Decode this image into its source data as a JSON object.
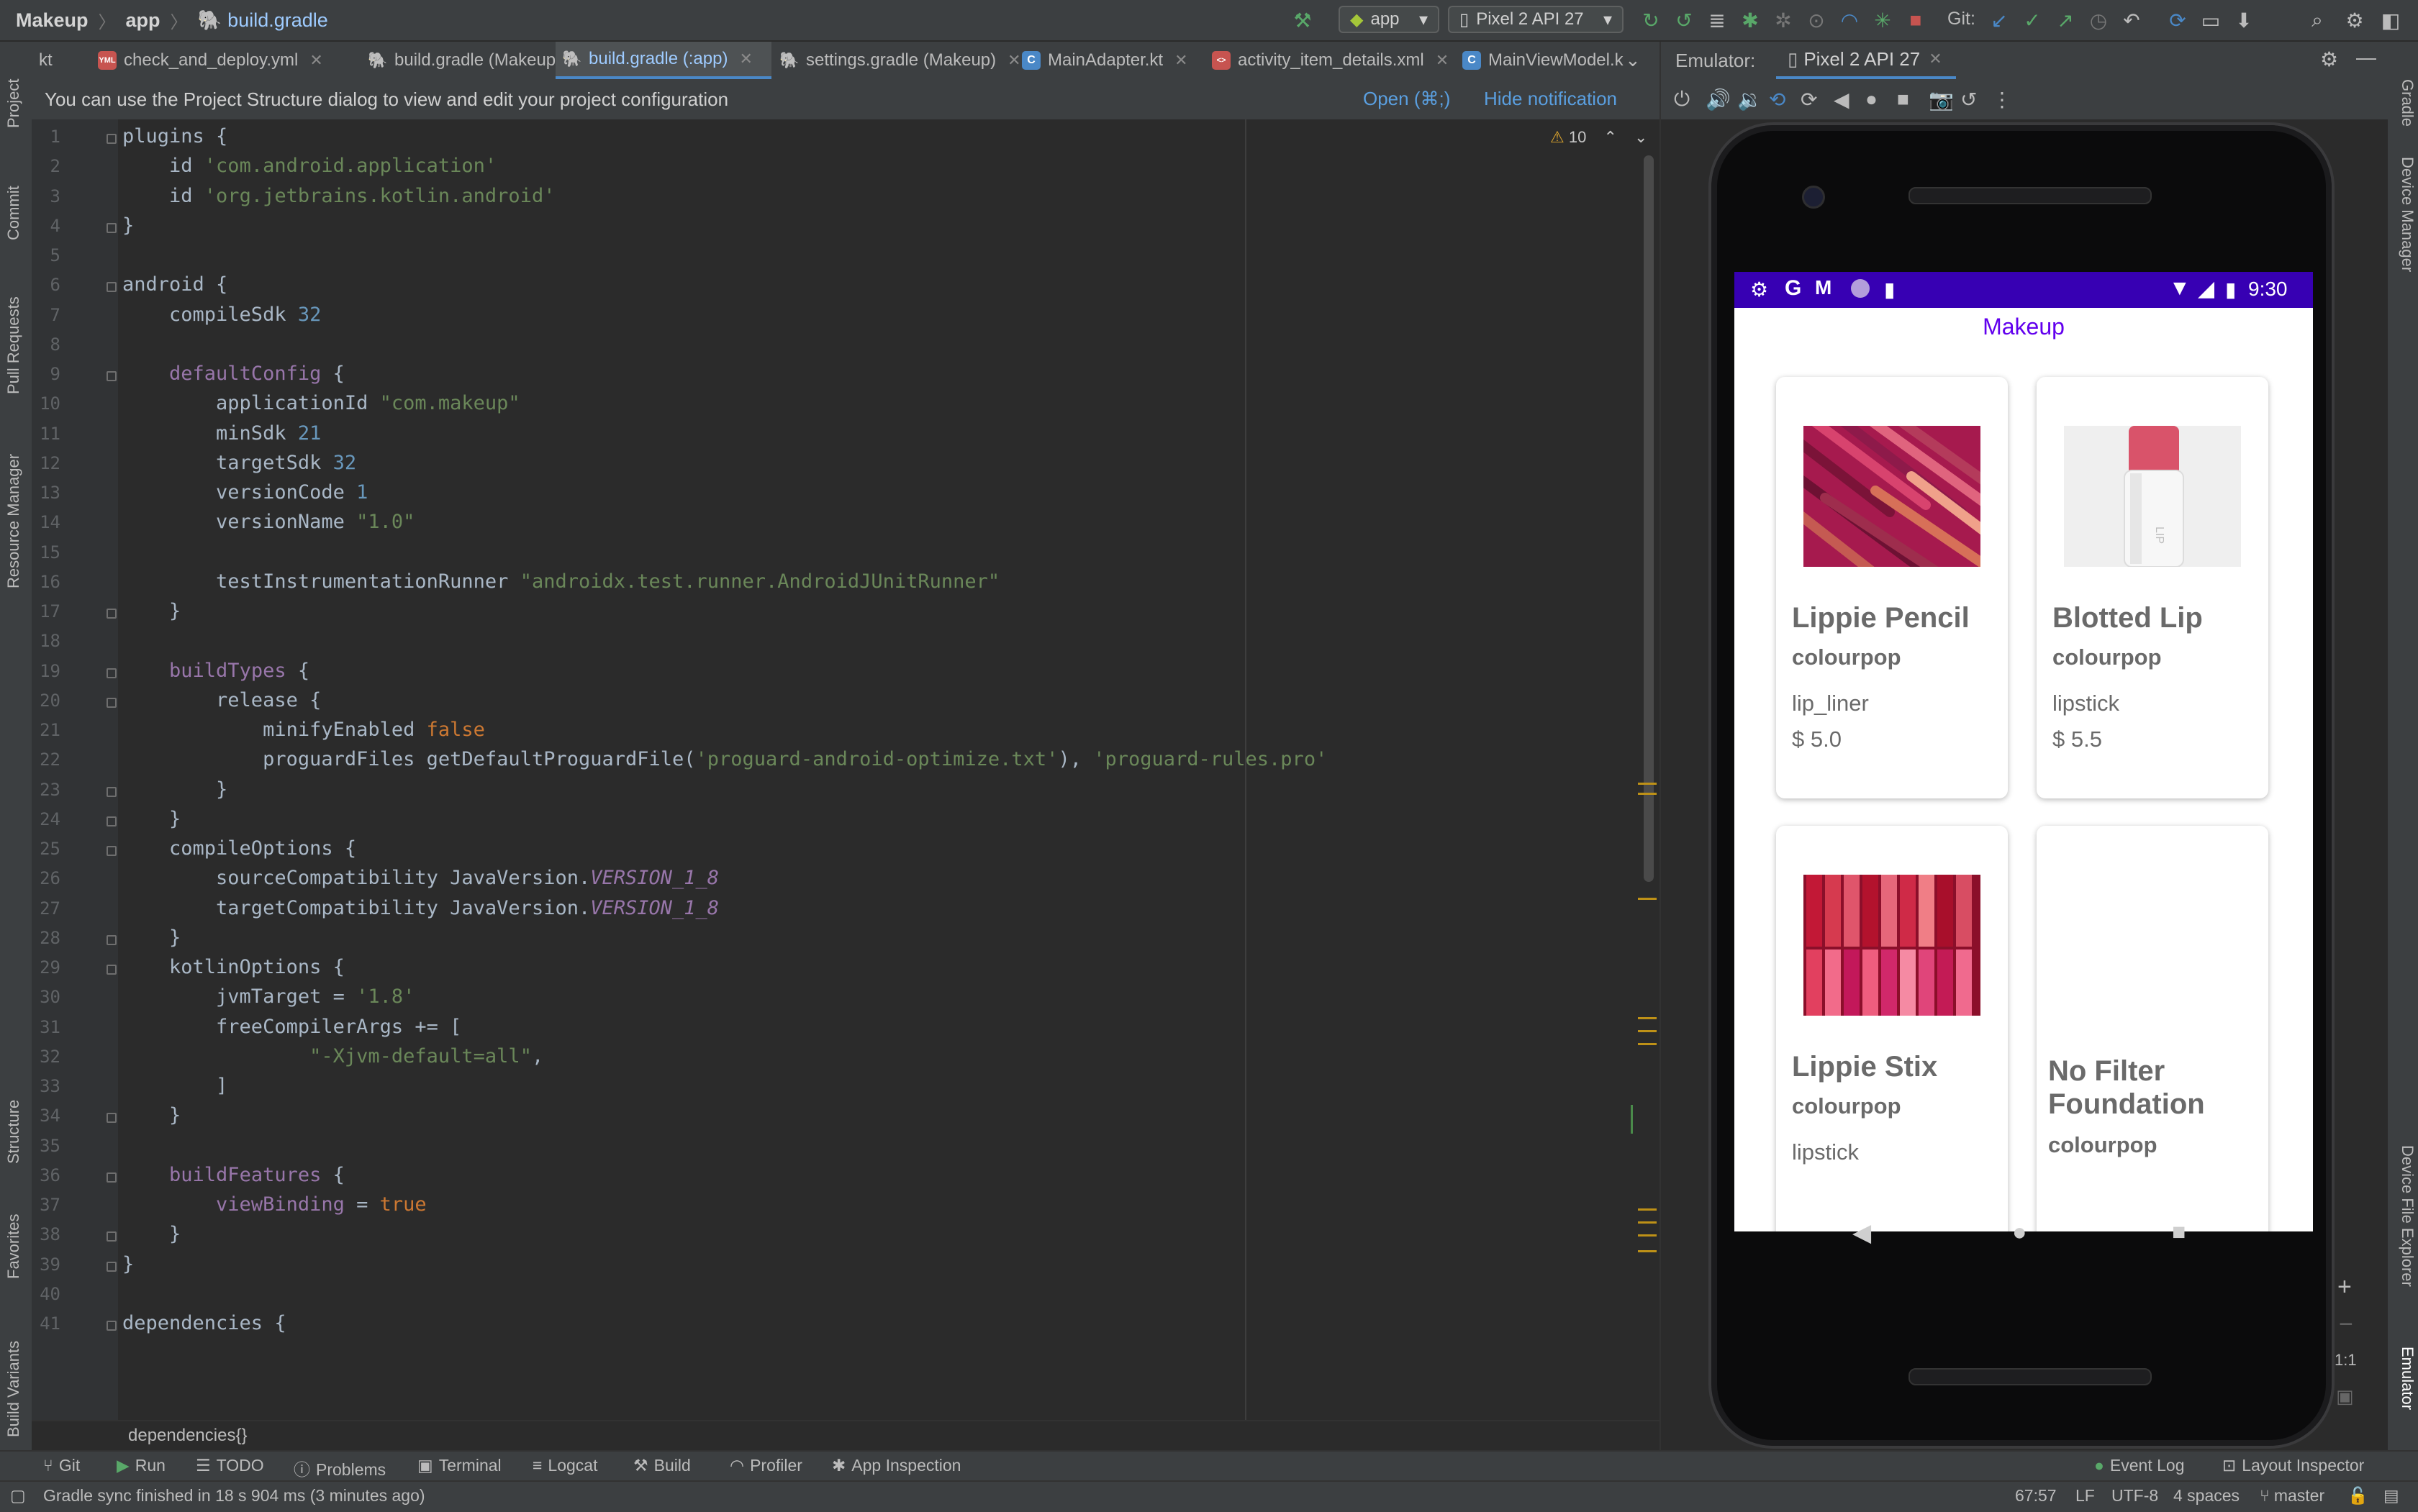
{
  "breadcrumb": {
    "project": "Makeup",
    "module": "app",
    "file": "build.gradle"
  },
  "run_toolbar": {
    "config": "app",
    "device": "Pixel 2 API 27",
    "git_label": "Git:"
  },
  "tabs": [
    {
      "label": "kt",
      "closable": false
    },
    {
      "label": "check_and_deploy.yml",
      "closable": true
    },
    {
      "label": "build.gradle (Makeup)",
      "closable": true
    },
    {
      "label": "build.gradle (:app)",
      "closable": true,
      "active": true
    },
    {
      "label": "settings.gradle (Makeup)",
      "closable": true
    },
    {
      "label": "MainAdapter.kt",
      "closable": true
    },
    {
      "label": "activity_item_details.xml",
      "closable": true
    },
    {
      "label": "MainViewModel.k",
      "closable": false
    }
  ],
  "notification": {
    "message": "You can use the Project Structure dialog to view and edit your project configuration",
    "open_label": "Open (⌘;)",
    "hide_label": "Hide notification"
  },
  "editor": {
    "warning_count": "10",
    "line_numbers": [
      "1",
      "2",
      "3",
      "4",
      "5",
      "6",
      "7",
      "8",
      "9",
      "10",
      "11",
      "12",
      "13",
      "14",
      "15",
      "16",
      "17",
      "18",
      "19",
      "20",
      "21",
      "22",
      "23",
      "24",
      "25",
      "26",
      "27",
      "28",
      "29",
      "30",
      "31",
      "32",
      "33",
      "34",
      "35",
      "36",
      "37",
      "38",
      "39",
      "40",
      "41"
    ],
    "code_lines": [
      "plugins {",
      "    id 'com.android.application'",
      "    id 'org.jetbrains.kotlin.android'",
      "}",
      "",
      "android {",
      "    compileSdk 32",
      "",
      "    defaultConfig {",
      "        applicationId \"com.makeup\"",
      "        minSdk 21",
      "        targetSdk 32",
      "        versionCode 1",
      "        versionName \"1.0\"",
      "",
      "        testInstrumentationRunner \"androidx.test.runner.AndroidJUnitRunner\"",
      "    }",
      "",
      "    buildTypes {",
      "        release {",
      "            minifyEnabled false",
      "            proguardFiles getDefaultProguardFile('proguard-android-optimize.txt'), 'proguard-rules.pro'",
      "        }",
      "    }",
      "    compileOptions {",
      "        sourceCompatibility JavaVersion.VERSION_1_8",
      "        targetCompatibility JavaVersion.VERSION_1_8",
      "    }",
      "    kotlinOptions {",
      "        jvmTarget = '1.8'",
      "        freeCompilerArgs += [",
      "                \"-Xjvm-default=all\",",
      "        ]",
      "    }",
      "",
      "    buildFeatures {",
      "        viewBinding = true",
      "    }",
      "}",
      "",
      "dependencies {"
    ],
    "breadcrumb": "dependencies{}"
  },
  "emulator": {
    "label": "Emulator:",
    "device_tab": "Pixel 2 API 27",
    "status_time": "9:30",
    "app_title": "Makeup",
    "products": [
      {
        "name": "Lippie Pencil",
        "brand": "colourpop",
        "category": "lip_liner",
        "price": "$ 5.0"
      },
      {
        "name": "Blotted Lip",
        "brand": "colourpop",
        "category": "lipstick",
        "price": "$ 5.5"
      },
      {
        "name": "Lippie Stix",
        "brand": "colourpop",
        "category": "lipstick",
        "price": ""
      },
      {
        "name": "No Filter Foundation",
        "brand": "colourpop",
        "category": "",
        "price": ""
      }
    ],
    "zoom_label": "1:1"
  },
  "left_tools": [
    "Project",
    "Commit",
    "Pull Requests",
    "Resource Manager",
    "Structure",
    "Favorites",
    "Build Variants"
  ],
  "right_tools": [
    "Gradle",
    "Device Manager",
    "Device File Explorer",
    "Emulator"
  ],
  "bottom_tools": [
    "Git",
    "Run",
    "TODO",
    "Problems",
    "Terminal",
    "Logcat",
    "Build",
    "Profiler",
    "App Inspection",
    "Event Log",
    "Layout Inspector"
  ],
  "status": {
    "message": "Gradle sync finished in 18 s 904 ms (3 minutes ago)",
    "position": "67:57",
    "line_sep": "LF",
    "encoding": "UTF-8",
    "indent": "4 spaces",
    "branch": "master"
  },
  "colors": {
    "accent": "#4a88c7",
    "app_bar": "#3700b3",
    "app_title": "#6200ee",
    "warning": "#be9117"
  }
}
